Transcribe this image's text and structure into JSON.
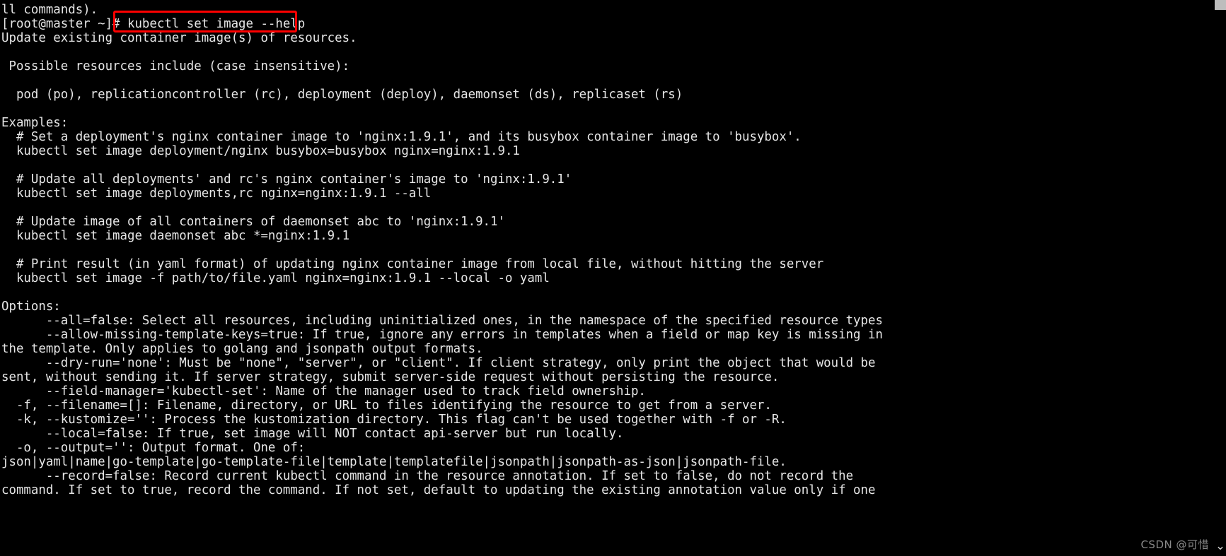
{
  "terminal": {
    "prompt": "[root@master ~]# ",
    "typed_command": "kubectl set image --help",
    "highlight_color": "#ff0000",
    "background_color": "#000000",
    "text_color": "#e6e6e6",
    "lines": [
      "ll commands).",
      "[root@master ~]# kubectl set image --help",
      "Update existing container image(s) of resources.",
      "",
      " Possible resources include (case insensitive):",
      "",
      "  pod (po), replicationcontroller (rc), deployment (deploy), daemonset (ds), replicaset (rs)",
      "",
      "Examples:",
      "  # Set a deployment's nginx container image to 'nginx:1.9.1', and its busybox container image to 'busybox'.",
      "  kubectl set image deployment/nginx busybox=busybox nginx=nginx:1.9.1",
      "",
      "  # Update all deployments' and rc's nginx container's image to 'nginx:1.9.1'",
      "  kubectl set image deployments,rc nginx=nginx:1.9.1 --all",
      "",
      "  # Update image of all containers of daemonset abc to 'nginx:1.9.1'",
      "  kubectl set image daemonset abc *=nginx:1.9.1",
      "",
      "  # Print result (in yaml format) of updating nginx container image from local file, without hitting the server",
      "  kubectl set image -f path/to/file.yaml nginx=nginx:1.9.1 --local -o yaml",
      "",
      "Options:",
      "      --all=false: Select all resources, including uninitialized ones, in the namespace of the specified resource types",
      "      --allow-missing-template-keys=true: If true, ignore any errors in templates when a field or map key is missing in",
      "the template. Only applies to golang and jsonpath output formats.",
      "      --dry-run='none': Must be \"none\", \"server\", or \"client\". If client strategy, only print the object that would be",
      "sent, without sending it. If server strategy, submit server-side request without persisting the resource.",
      "      --field-manager='kubectl-set': Name of the manager used to track field ownership.",
      "  -f, --filename=[]: Filename, directory, or URL to files identifying the resource to get from a server.",
      "  -k, --kustomize='': Process the kustomization directory. This flag can't be used together with -f or -R.",
      "      --local=false: If true, set image will NOT contact api-server but run locally.",
      "  -o, --output='': Output format. One of:",
      "json|yaml|name|go-template|go-template-file|template|templatefile|jsonpath|jsonpath-as-json|jsonpath-file.",
      "      --record=false: Record current kubectl command in the resource annotation. If set to false, do not record the",
      "command. If set to true, record the command. If not set, default to updating the existing annotation value only if one"
    ]
  },
  "watermark": {
    "text": "CSDN @可惜"
  },
  "scrollbar": {
    "down_arrow_glyph": "⌄"
  }
}
